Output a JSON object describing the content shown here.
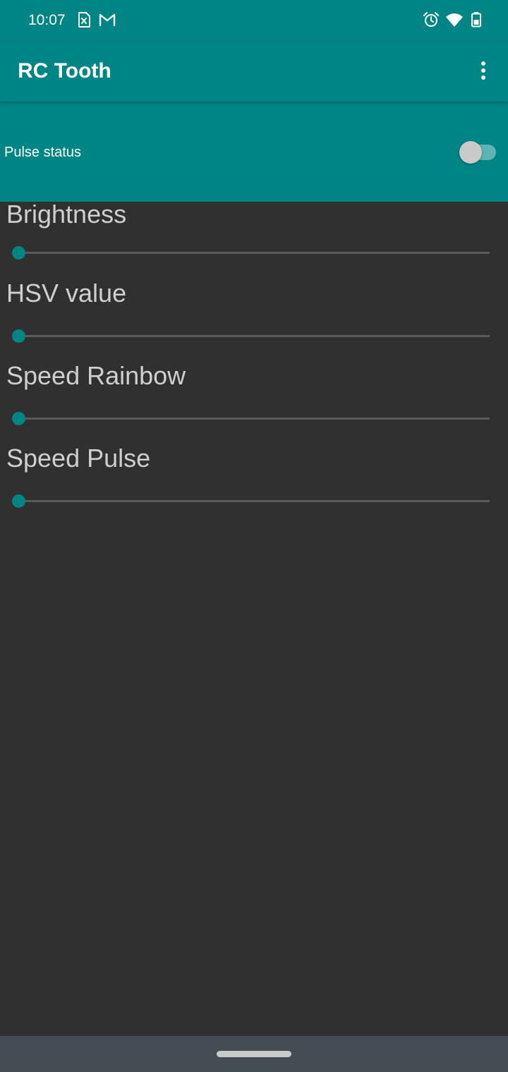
{
  "status_bar": {
    "time": "10:07",
    "left_icons": [
      "sim-card-icon",
      "gmail-icon"
    ],
    "right_icons": [
      "alarm-icon",
      "wifi-icon",
      "battery-icon"
    ]
  },
  "app_bar": {
    "title": "RC Tooth",
    "menu_icon": "more-vert-icon"
  },
  "pulse": {
    "label": "Pulse status",
    "enabled": false
  },
  "sliders": [
    {
      "label": "Brightness",
      "value": 0
    },
    {
      "label": "HSV value",
      "value": 0
    },
    {
      "label": "Speed Rainbow",
      "value": 0
    },
    {
      "label": "Speed Pulse",
      "value": 0
    }
  ],
  "colors": {
    "primary": "#008585",
    "background": "#303030",
    "text": "#cfcfcf",
    "nav_bar": "#464c54"
  }
}
